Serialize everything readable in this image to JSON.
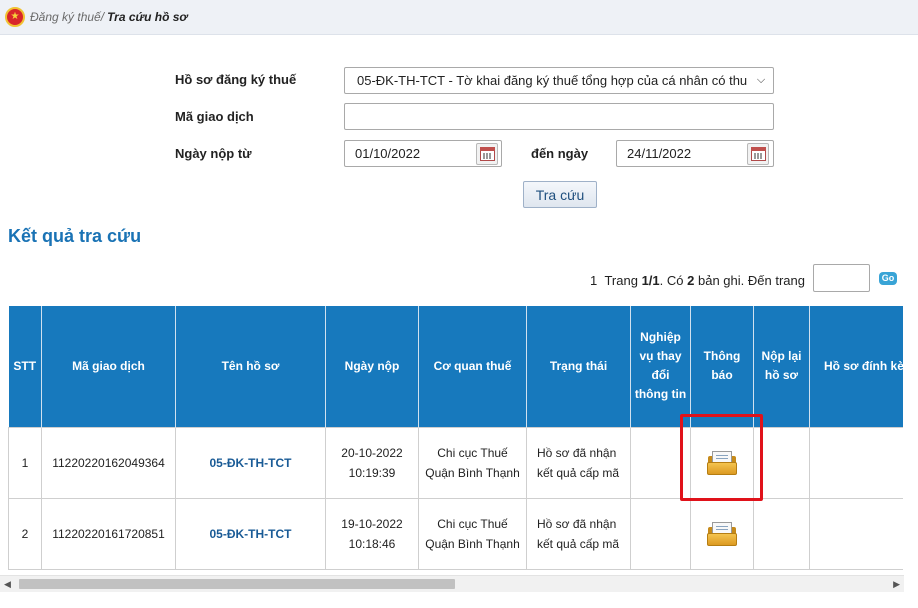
{
  "breadcrumb": {
    "parent": "Đăng ký thuế",
    "separator": "/",
    "current": "Tra cứu hồ sơ"
  },
  "form": {
    "ho_so_label": "Hồ sơ đăng ký thuế",
    "ho_so_selected": "05-ĐK-TH-TCT - Tờ khai đăng ký thuế tổng hợp của cá nhân có thu",
    "ma_giao_dich_label": "Mã giao dịch",
    "ma_giao_dich_value": "",
    "ngay_nop_tu_label": "Ngày nộp từ",
    "ngay_nop_tu_value": "01/10/2022",
    "den_ngay_label": "đến ngày",
    "den_ngay_value": "24/11/2022",
    "search_button": "Tra cứu"
  },
  "results": {
    "title": "Kết quả tra cứu",
    "pager": {
      "current_page": "1",
      "trang_label": "Trang",
      "page_of": "1/1",
      "co_label": "Có",
      "record_count": "2",
      "records_label": "bản ghi. Đến trang",
      "go_label": "Go"
    },
    "columns": {
      "stt": "STT",
      "ma_giao_dich": "Mã giao dịch",
      "ten_ho_so": "Tên hồ sơ",
      "ngay_nop": "Ngày nộp",
      "co_quan_thue": "Cơ quan thuế",
      "trang_thai": "Trạng thái",
      "nghiep_vu": "Nghiệp vụ thay đổi thông tin",
      "thong_bao": "Thông báo",
      "nop_lai": "Nộp lại hồ sơ",
      "dinh_kem": "Hồ sơ đính kèm"
    },
    "rows": [
      {
        "stt": "1",
        "ma_giao_dich": "11220220162049364",
        "ten_ho_so": "05-ĐK-TH-TCT",
        "ngay_nop_date": "20-10-2022",
        "ngay_nop_time": "10:19:39",
        "co_quan_thue": "Chi cục Thuế Quận Bình Thạnh",
        "trang_thai": "Hồ sơ đã nhận kết quả cấp mã",
        "thong_bao_icon": "folder-document-icon"
      },
      {
        "stt": "2",
        "ma_giao_dich": "11220220161720851",
        "ten_ho_so": "05-ĐK-TH-TCT",
        "ngay_nop_date": "19-10-2022",
        "ngay_nop_time": "10:18:46",
        "co_quan_thue": "Chi cục Thuế Quận Bình Thạnh",
        "trang_thai": "Hồ sơ đã nhận kết quả cấp mã",
        "thong_bao_icon": "folder-document-icon"
      }
    ]
  },
  "colors": {
    "header_blue": "#1779bd",
    "title_blue": "#1a73b5",
    "highlight_red": "#e0121a"
  }
}
